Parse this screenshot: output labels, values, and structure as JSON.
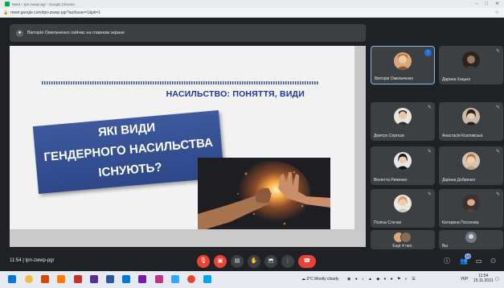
{
  "browser": {
    "tab_title": "Meet – tpn-zwwp-pgr - Google Chrome",
    "url": "meet.google.com/tpn-zwwp-pgr?authuser=1&pli=1",
    "window_controls": [
      "–",
      "□",
      "✕"
    ]
  },
  "presenting_banner": {
    "text": "Вікторія Омельченко сейчас на главном экране"
  },
  "slide": {
    "title": "НАСИЛЬСТВО: ПОНЯТТЯ, ВИДИ",
    "box_lines": [
      "ЯКІ ВИДИ",
      "ГЕНДЕРНОГО НАСИЛЬСТВА",
      "ІСНУЮТЬ?"
    ],
    "accent_color": "#2d4789"
  },
  "participants": [
    {
      "name": "Вікторія Омельченко",
      "speaking": true
    },
    {
      "name": "Дарина Хацько",
      "speaking": false
    },
    {
      "name": "Дмитро Сергєєв",
      "speaking": false
    },
    {
      "name": "Анастасія Козловська",
      "speaking": false
    },
    {
      "name": "Віолетта Риженко",
      "speaking": false
    },
    {
      "name": "Дарина Добренко",
      "speaking": false
    },
    {
      "name": "Поліна Слєчак",
      "speaking": false
    },
    {
      "name": "Катерина Посохова",
      "speaking": false
    },
    {
      "name": "Ещё 4 чел.",
      "speaking": false
    },
    {
      "name": "Вы",
      "speaking": false
    }
  ],
  "controls": {
    "time": "11:54",
    "meeting_code": "tpn-zwwp-pgr",
    "participant_count": "14"
  },
  "taskbar": {
    "weather": "3°C Mostly cloudy",
    "language": "УКР",
    "clock_time": "11:54",
    "clock_date": "15.11.2021"
  }
}
